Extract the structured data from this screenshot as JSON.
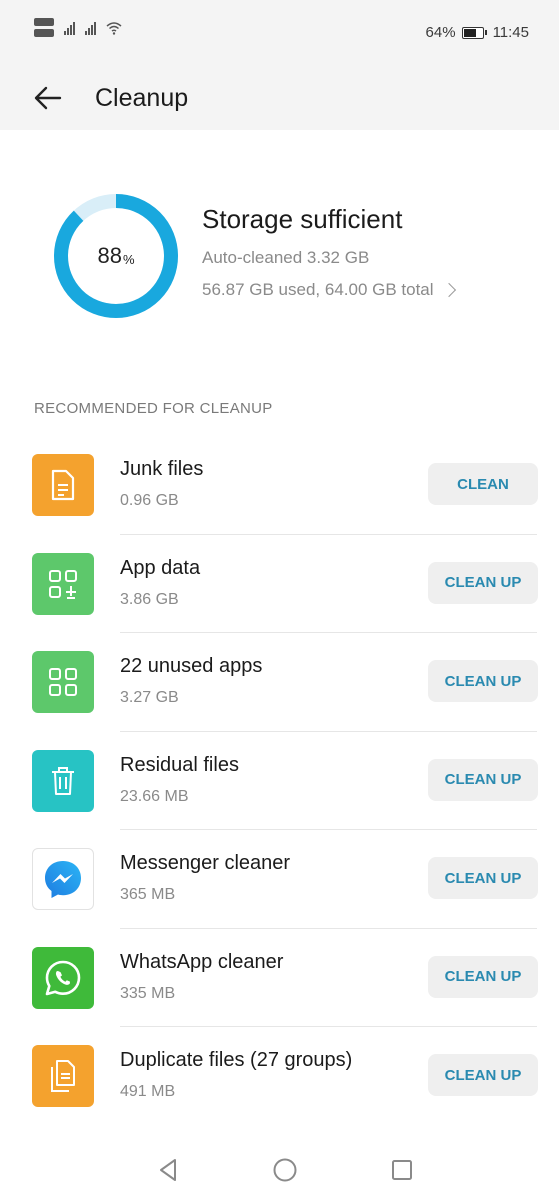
{
  "status_bar": {
    "battery_percent": "64%",
    "battery_level": 0.64,
    "time": "11:45",
    "icons": [
      "sim-icon",
      "signal-icon",
      "signal-icon",
      "wifi-icon",
      "battery-icon"
    ]
  },
  "header": {
    "title": "Cleanup",
    "back_icon": "back-arrow-icon"
  },
  "storage": {
    "percent_value": "88",
    "percent_unit": "%",
    "ring_fraction": 0.88,
    "status": "Storage sufficient",
    "auto_cleaned": "Auto-cleaned 3.32 GB",
    "usage": "56.87 GB used, 64.00 GB total",
    "ring_color": "#19a8de",
    "ring_track_color": "#d9eef8"
  },
  "section_title": "RECOMMENDED FOR CLEANUP",
  "items": [
    {
      "name": "Junk files",
      "size": "0.96 GB",
      "button": "CLEAN",
      "icon": "junk-files-icon",
      "color": "#f4a22e"
    },
    {
      "name": "App data",
      "size": "3.86 GB",
      "button": "CLEAN UP",
      "icon": "app-data-icon",
      "color": "#5dc86b"
    },
    {
      "name": "22 unused apps",
      "size": "3.27 GB",
      "button": "CLEAN UP",
      "icon": "unused-apps-icon",
      "color": "#5dc86b"
    },
    {
      "name": "Residual files",
      "size": "23.66 MB",
      "button": "CLEAN UP",
      "icon": "trash-icon",
      "color": "#27c3c4"
    },
    {
      "name": "Messenger cleaner",
      "size": "365 MB",
      "button": "CLEAN UP",
      "icon": "messenger-icon",
      "color": "#ffffff"
    },
    {
      "name": "WhatsApp cleaner",
      "size": "335 MB",
      "button": "CLEAN UP",
      "icon": "whatsapp-icon",
      "color": "#3fba3a"
    },
    {
      "name": "Duplicate files (27 groups)",
      "size": "491 MB",
      "button": "CLEAN UP",
      "icon": "duplicate-files-icon",
      "color": "#f4a22e"
    }
  ],
  "nav": {
    "icons": [
      "back-triangle-icon",
      "home-circle-icon",
      "recents-square-icon"
    ]
  },
  "accent_color": "#2a8ab0"
}
